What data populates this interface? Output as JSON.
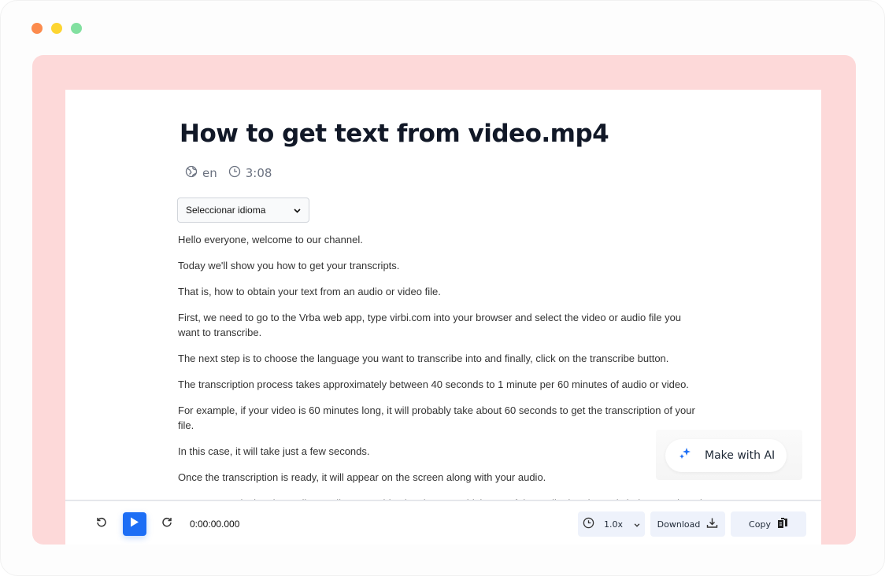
{
  "window": {
    "controls": [
      {
        "name": "close",
        "color": "#fc8b4d"
      },
      {
        "name": "minimize",
        "color": "#fdd531"
      },
      {
        "name": "maximize",
        "color": "#82e0a0"
      }
    ],
    "frame_color": "#fdd9d9"
  },
  "document": {
    "title": "How to get text from video.mp4",
    "language": "en",
    "duration": "3:08",
    "language_select": {
      "selected": "Seleccionar idioma"
    },
    "paragraphs": [
      "Hello everyone, welcome to our channel.",
      "Today we'll show you how to get your transcripts.",
      "That is, how to obtain your text from an audio or video file.",
      "First, we need to go to the Vrba web app, type virbi.com into your browser and select the video or audio file you want to transcribe.",
      "The next step is to choose the language you want to transcribe into and finally, click on the transcribe button.",
      "The transcription process takes approximately between 40 seconds to 1 minute per 60 minutes of audio or video.",
      "For example, if your video is 60 minutes long, it will probably take about 60 seconds to get the transcription of your file.",
      "In this case, it will take just a few seconds.",
      "Once the transcription is ready, it will appear on the screen along with your audio.",
      "As you start playing the audio, you'll see a guide showing you which part of the audio the phrase is being mentioned."
    ]
  },
  "ai_button": {
    "label": "Make with AI",
    "icon": "sparkles-icon",
    "accent": "#1d6ef5"
  },
  "player": {
    "current_time": "0:00:00.000",
    "speed": "1.0x",
    "download_label": "Download",
    "copy_label": "Copy",
    "accent": "#1d6ef5"
  }
}
